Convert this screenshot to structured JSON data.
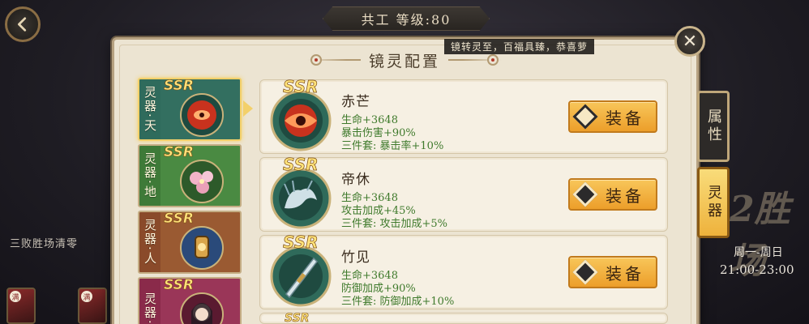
{
  "header": {
    "level_text": "共工 等级:80"
  },
  "panel": {
    "title": "镜灵配置",
    "set_note": "镜转灵至，百福具臻，恭喜萝"
  },
  "background": {
    "left_text": "三败胜场清零",
    "right_big": "2胜场",
    "right_days": "周一-周日",
    "right_time": "21:00-23:00",
    "mini_tags": [
      "满",
      "满"
    ]
  },
  "slots": [
    {
      "label": "灵器·天",
      "rarity": "SSR",
      "color": "#2f6b5c",
      "active": true
    },
    {
      "label": "灵器·地",
      "rarity": "SSR",
      "color": "#3f7a3a",
      "active": false
    },
    {
      "label": "灵器·人",
      "rarity": "SSR",
      "color": "#8a4a2a",
      "active": false
    },
    {
      "label": "灵器·",
      "rarity": "SSR",
      "color": "#8a2a4a",
      "active": false
    }
  ],
  "items": [
    {
      "rarity": "SSR",
      "name": "赤芒",
      "stat1": "生命+3648",
      "stat2": "暴击伤害+90%",
      "stat3": "三件套: 暴击率+10%",
      "button": "装备",
      "icon": "red-eye-artifact-icon"
    },
    {
      "rarity": "SSR",
      "name": "帝休",
      "stat1": "生命+3648",
      "stat2": "攻击加成+45%",
      "stat3": "三件套: 攻击加成+5%",
      "button": "装备",
      "icon": "dragon-artifact-icon"
    },
    {
      "rarity": "SSR",
      "name": "竹见",
      "stat1": "生命+3648",
      "stat2": "防御加成+90%",
      "stat3": "三件套: 防御加成+10%",
      "button": "装备",
      "icon": "blade-artifact-icon"
    },
    {
      "rarity": "SSR"
    }
  ],
  "side_tabs": {
    "attributes": "属性",
    "spirit": "灵器"
  },
  "colors": {
    "panel_bg": "#ece4d2",
    "stat_green": "#3f7a2c",
    "button_gold": "#f8c65a",
    "active_tab": "#f3d06a"
  }
}
